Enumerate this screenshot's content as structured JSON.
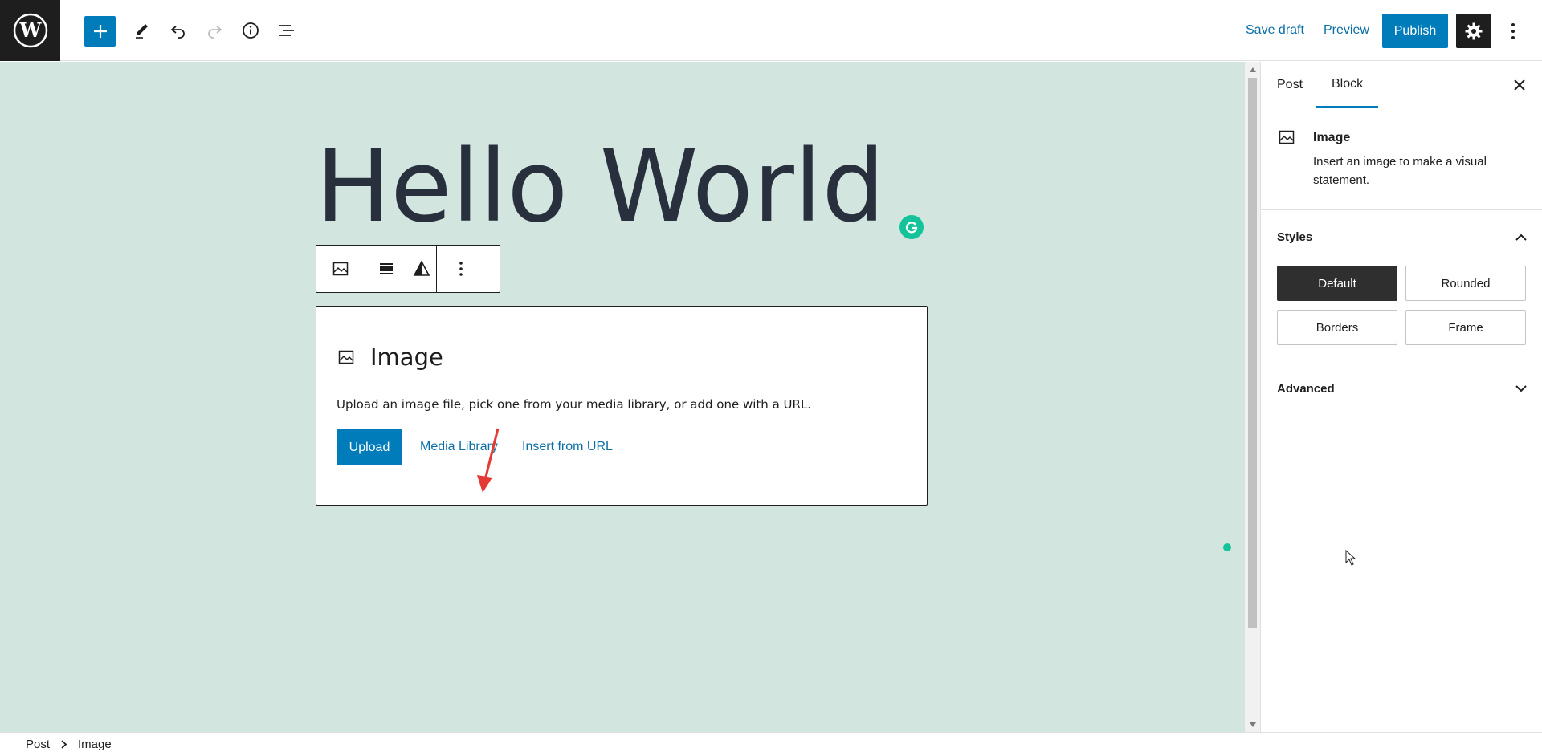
{
  "toolbar": {
    "save_draft": "Save draft",
    "preview": "Preview",
    "publish": "Publish"
  },
  "post": {
    "title": "Hello World"
  },
  "image_block": {
    "title": "Image",
    "instructions": "Upload an image file, pick one from your media library, or add one with a URL.",
    "upload": "Upload",
    "media_library": "Media Library",
    "insert_from_url": "Insert from URL"
  },
  "sidebar": {
    "tabs": [
      "Post",
      "Block"
    ],
    "active_tab": "Block",
    "block_card": {
      "title": "Image",
      "description": "Insert an image to make a visual statement."
    },
    "styles": {
      "heading": "Styles",
      "options": [
        "Default",
        "Rounded",
        "Borders",
        "Frame"
      ],
      "selected": "Default"
    },
    "advanced": {
      "heading": "Advanced"
    }
  },
  "breadcrumb": [
    "Post",
    "Image"
  ],
  "colors": {
    "accent": "#007cba",
    "canvas_bg": "#d2e5de",
    "dark": "#1e1e1e",
    "grammarly": "#15c39a",
    "annotation_arrow": "#e53935"
  }
}
